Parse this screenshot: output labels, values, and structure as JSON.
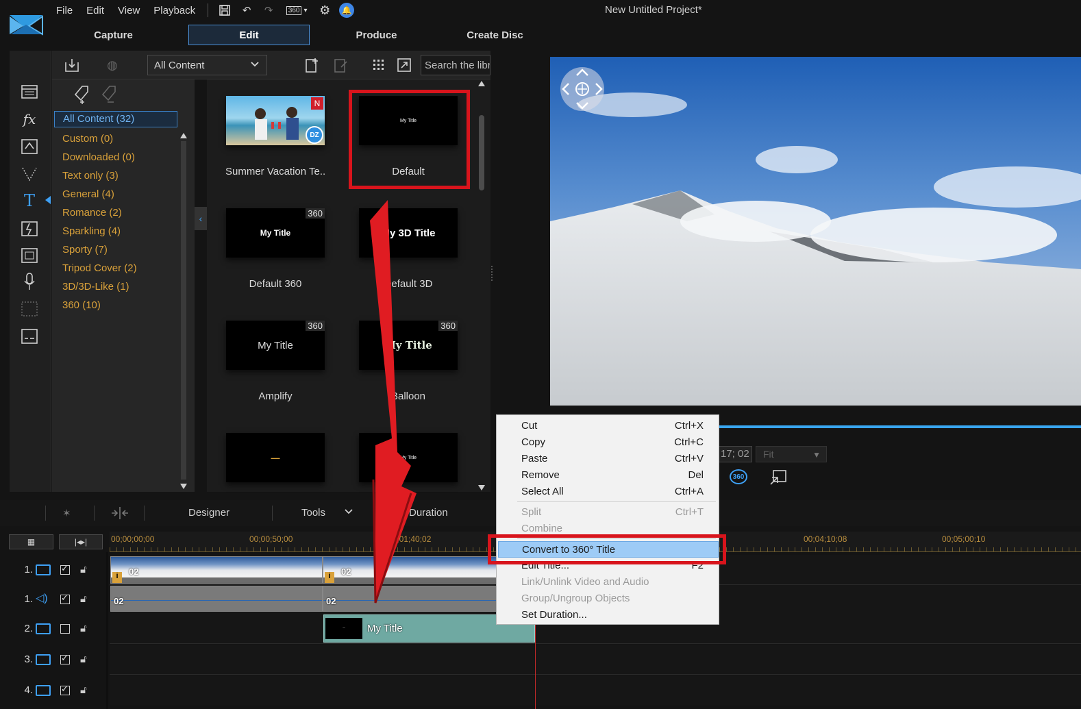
{
  "app": {
    "project_title": "New Untitled Project*"
  },
  "menu": [
    "File",
    "Edit",
    "View",
    "Playback"
  ],
  "toolbar": {
    "badge_360": "360"
  },
  "tabs": [
    {
      "label": "Capture",
      "active": false
    },
    {
      "label": "Edit",
      "active": true
    },
    {
      "label": "Produce",
      "active": false
    },
    {
      "label": "Create Disc",
      "active": false
    }
  ],
  "library": {
    "dropdown_value": "All Content",
    "search_placeholder": "Search the libra",
    "categories": [
      {
        "label": "All Content (32)",
        "selected": true
      },
      {
        "label": "Custom  (0)"
      },
      {
        "label": "Downloaded  (0)"
      },
      {
        "label": "Text only  (3)"
      },
      {
        "label": "General  (4)"
      },
      {
        "label": "Romance  (2)"
      },
      {
        "label": "Sparkling  (4)"
      },
      {
        "label": "Sporty  (7)"
      },
      {
        "label": "Tripod Cover  (2)"
      },
      {
        "label": "3D/3D-Like  (1)"
      },
      {
        "label": "360  (10)"
      }
    ],
    "tiles": [
      {
        "label": "Summer Vacation Te...",
        "thumb_text": "",
        "badge": "N",
        "badge_dz": "DZ"
      },
      {
        "label": "Default",
        "thumb_text": "My Title",
        "badge": ""
      },
      {
        "label": "Default 360",
        "thumb_text": "My Title",
        "badge": "360"
      },
      {
        "label": "Default 3D",
        "thumb_text": "My 3D Title",
        "badge": ""
      },
      {
        "label": "Amplify",
        "thumb_text": "My Title",
        "badge": "360"
      },
      {
        "label": "Balloon",
        "thumb_text": "My Title",
        "badge": "360"
      },
      {
        "label": "",
        "thumb_text": "—",
        "badge": ""
      },
      {
        "label": "",
        "thumb_text": "My Title",
        "badge": ""
      }
    ]
  },
  "preview": {
    "time": "17; 02",
    "fit": "Fit",
    "badge_360": "360"
  },
  "timeline_toolbar": {
    "designer": "Designer",
    "tools": "Tools",
    "duration": "Duration"
  },
  "ruler": {
    "marks": [
      "00;00;00;00",
      "00;00;50;00",
      "00;01;40;02",
      "00;04;10;08",
      "00;05;00;10"
    ]
  },
  "tracks": [
    {
      "num": "1.",
      "type": "video",
      "checked": true
    },
    {
      "num": "1.",
      "type": "audio",
      "checked": true
    },
    {
      "num": "2.",
      "type": "video",
      "checked": false
    },
    {
      "num": "3.",
      "type": "video",
      "checked": true
    },
    {
      "num": "4.",
      "type": "video",
      "checked": true
    }
  ],
  "clips": {
    "label_a": "02",
    "label_b": "02",
    "label_c": "02",
    "label_d": "02",
    "title_clip": "My Title"
  },
  "context_menu": {
    "items": [
      {
        "label": "Cut",
        "shortcut": "Ctrl+X",
        "disabled": false
      },
      {
        "label": "Copy",
        "shortcut": "Ctrl+C",
        "disabled": false
      },
      {
        "label": "Paste",
        "shortcut": "Ctrl+V",
        "disabled": false
      },
      {
        "label": "Remove",
        "shortcut": "Del",
        "disabled": false
      },
      {
        "label": "Select All",
        "shortcut": "Ctrl+A",
        "disabled": false
      },
      {
        "label": "Split",
        "shortcut": "Ctrl+T",
        "disabled": true
      },
      {
        "label": "Combine",
        "shortcut": "",
        "disabled": true
      },
      {
        "label": "Convert to 360° Title",
        "shortcut": "",
        "disabled": false,
        "highlighted": true
      },
      {
        "label": "Edit Title...",
        "shortcut": "F2",
        "disabled": false
      },
      {
        "label": "Link/Unlink Video and Audio",
        "shortcut": "",
        "disabled": true
      },
      {
        "label": "Group/Ungroup Objects",
        "shortcut": "",
        "disabled": true
      },
      {
        "label": "Set Duration...",
        "shortcut": "",
        "disabled": false
      }
    ]
  },
  "colors": {
    "accent": "#3ea0f5",
    "annotation_red": "#d8141c",
    "category_text": "#d9a13a",
    "highlight": "#9dcbf6"
  }
}
